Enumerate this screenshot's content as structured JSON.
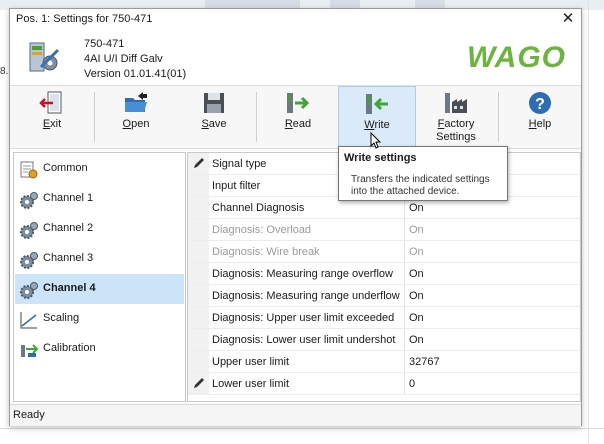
{
  "window": {
    "title": "Pos. 1: Settings for 750-471",
    "close_glyph": "✕"
  },
  "device": {
    "part_number": "750-471",
    "description": "4AI U/I Diff Galv",
    "version": "Version 01.01.41(01)",
    "logo_text": "WAGO",
    "brand_color": "#6db33f"
  },
  "toolbar": {
    "buttons": [
      {
        "id": "exit",
        "hotkey": "E",
        "rest": "xit",
        "line2": "",
        "icon": "exit-icon"
      },
      {
        "id": "open",
        "hotkey": "O",
        "rest": "pen",
        "line2": "",
        "icon": "open-folder-icon"
      },
      {
        "id": "save",
        "hotkey": "S",
        "rest": "ave",
        "line2": "",
        "icon": "save-disk-icon"
      },
      {
        "id": "read",
        "hotkey": "R",
        "rest": "ead",
        "line2": "",
        "icon": "read-icon"
      },
      {
        "id": "write",
        "hotkey": "W",
        "rest": "rite",
        "line2": "",
        "icon": "write-icon"
      },
      {
        "id": "factory",
        "hotkey": "F",
        "rest": "actory",
        "line2": "Settings",
        "icon": "factory-icon"
      },
      {
        "id": "help",
        "hotkey": "H",
        "rest": "elp",
        "line2": "",
        "icon": "help-icon"
      }
    ],
    "active": "write"
  },
  "nav": {
    "items": [
      {
        "label": "Common",
        "icon": "document-gear-icon"
      },
      {
        "label": "Channel 1",
        "icon": "gears-icon"
      },
      {
        "label": "Channel 2",
        "icon": "gears-icon"
      },
      {
        "label": "Channel 3",
        "icon": "gears-icon"
      },
      {
        "label": "Channel 4",
        "icon": "gears-icon"
      },
      {
        "label": "Scaling",
        "icon": "scaling-chart-icon"
      },
      {
        "label": "Calibration",
        "icon": "calibration-icon"
      }
    ],
    "selected": "Channel 4"
  },
  "grid": {
    "rows": [
      {
        "name": "Signal type",
        "value": "",
        "pencil": true,
        "disabled": false
      },
      {
        "name": "Input filter",
        "value": "",
        "pencil": false,
        "disabled": false
      },
      {
        "name": "Channel Diagnosis",
        "value": "On",
        "pencil": false,
        "disabled": false
      },
      {
        "name": "Diagnosis: Overload",
        "value": "On",
        "pencil": false,
        "disabled": true
      },
      {
        "name": "Diagnosis: Wire break",
        "value": "On",
        "pencil": false,
        "disabled": true
      },
      {
        "name": "Diagnosis: Measuring range overflow",
        "value": "On",
        "pencil": false,
        "disabled": false
      },
      {
        "name": "Diagnosis: Measuring range underflow",
        "value": "On",
        "pencil": false,
        "disabled": false
      },
      {
        "name": "Diagnosis: Upper user limit exceeded",
        "value": "On",
        "pencil": false,
        "disabled": false
      },
      {
        "name": "Diagnosis: Lower user limit undershot",
        "value": "On",
        "pencil": false,
        "disabled": false
      },
      {
        "name": "Upper user limit",
        "value": "32767",
        "pencil": false,
        "disabled": false
      },
      {
        "name": "Lower user limit",
        "value": "0",
        "pencil": true,
        "disabled": false
      }
    ]
  },
  "tooltip": {
    "title": "Write settings",
    "body": "Transfers the indicated settings into the attached device."
  },
  "status": {
    "text": "Ready"
  },
  "background": {
    "left_fragment": "8."
  }
}
